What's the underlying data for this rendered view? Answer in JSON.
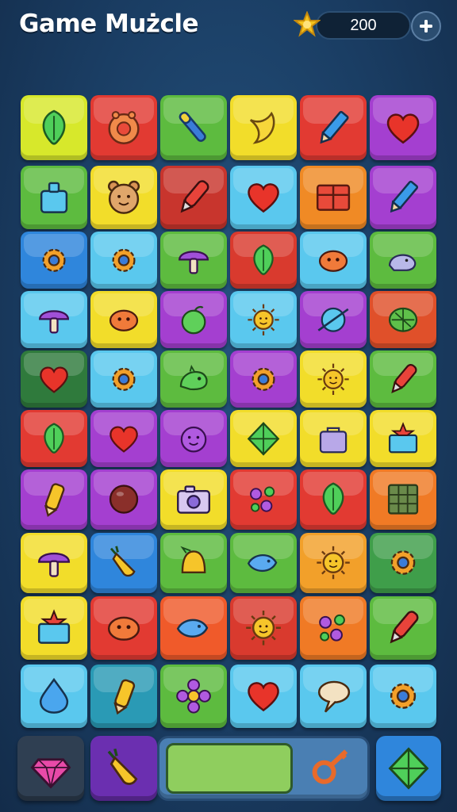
{
  "header": {
    "title": "Game Mużcle",
    "coins": "200",
    "coin_icon": "star-coin-icon",
    "add_icon": "plus-icon"
  },
  "board": {
    "rows": 10,
    "cols": 6,
    "tiles": [
      [
        {
          "color": "#d7e82b",
          "icon": "leaf"
        },
        {
          "color": "#e23a32",
          "icon": "clock"
        },
        {
          "color": "#5dbb3f",
          "icon": "pen"
        },
        {
          "color": "#f2dd2a",
          "icon": "banana"
        },
        {
          "color": "#e23a32",
          "icon": "pencil"
        },
        {
          "color": "#a43fd0",
          "icon": "heart"
        }
      ],
      [
        {
          "color": "#5dbb3f",
          "icon": "bottle"
        },
        {
          "color": "#f2dd2a",
          "icon": "bear"
        },
        {
          "color": "#c8352d",
          "icon": "marker"
        },
        {
          "color": "#5ac8ee",
          "icon": "heart"
        },
        {
          "color": "#f08a25",
          "icon": "crate"
        },
        {
          "color": "#a43fd0",
          "icon": "pencil"
        }
      ],
      [
        {
          "color": "#2f86dc",
          "icon": "gear"
        },
        {
          "color": "#5ac8ee",
          "icon": "gear"
        },
        {
          "color": "#5dbb3f",
          "icon": "mushroom"
        },
        {
          "color": "#d93a2e",
          "icon": "leaf"
        },
        {
          "color": "#5ac8ee",
          "icon": "blob"
        },
        {
          "color": "#5dbb3f",
          "icon": "whale"
        }
      ],
      [
        {
          "color": "#5ac8ee",
          "icon": "mushroom"
        },
        {
          "color": "#f2dd2a",
          "icon": "blob"
        },
        {
          "color": "#a43fd0",
          "icon": "apple"
        },
        {
          "color": "#5ac8ee",
          "icon": "sun"
        },
        {
          "color": "#a43fd0",
          "icon": "planet"
        },
        {
          "color": "#e0502a",
          "icon": "melon"
        }
      ],
      [
        {
          "color": "#2f7a3c",
          "icon": "heart"
        },
        {
          "color": "#5ac8ee",
          "icon": "gear"
        },
        {
          "color": "#5dbb3f",
          "icon": "dino"
        },
        {
          "color": "#a43fd0",
          "icon": "gear"
        },
        {
          "color": "#f2dd2a",
          "icon": "sun"
        },
        {
          "color": "#5dbb3f",
          "icon": "marker"
        }
      ],
      [
        {
          "color": "#e23a32",
          "icon": "leaf"
        },
        {
          "color": "#a43fd0",
          "icon": "heart"
        },
        {
          "color": "#a43fd0",
          "icon": "face"
        },
        {
          "color": "#f2dd2a",
          "icon": "kite"
        },
        {
          "color": "#f2dd2a",
          "icon": "bag"
        },
        {
          "color": "#f2dd2a",
          "icon": "box"
        }
      ],
      [
        {
          "color": "#a43fd0",
          "icon": "crayon"
        },
        {
          "color": "#a43fd0",
          "icon": "ball"
        },
        {
          "color": "#f2dd2a",
          "icon": "camera"
        },
        {
          "color": "#e23a32",
          "icon": "flowers"
        },
        {
          "color": "#e23a32",
          "icon": "leaf"
        },
        {
          "color": "#f07a25",
          "icon": "window"
        }
      ],
      [
        {
          "color": "#f2dd2a",
          "icon": "mushroom"
        },
        {
          "color": "#2f86dc",
          "icon": "carrot"
        },
        {
          "color": "#5dbb3f",
          "icon": "bell"
        },
        {
          "color": "#5dbb3f",
          "icon": "fish"
        },
        {
          "color": "#f2a02a",
          "icon": "sun"
        },
        {
          "color": "#3f9e4a",
          "icon": "gear"
        }
      ],
      [
        {
          "color": "#f2dd2a",
          "icon": "box"
        },
        {
          "color": "#e23a32",
          "icon": "blob"
        },
        {
          "color": "#f05a2a",
          "icon": "fish"
        },
        {
          "color": "#d93a2e",
          "icon": "sun"
        },
        {
          "color": "#f07a25",
          "icon": "flowers"
        },
        {
          "color": "#5dbb3f",
          "icon": "marker"
        }
      ],
      [
        {
          "color": "#5ac8ee",
          "icon": "drop"
        },
        {
          "color": "#2a9ab5",
          "icon": "crayon"
        },
        {
          "color": "#5dbb3f",
          "icon": "flower"
        },
        {
          "color": "#5ac8ee",
          "icon": "heart"
        },
        {
          "color": "#5ac8ee",
          "icon": "speech"
        },
        {
          "color": "#5ac8ee",
          "icon": "gear"
        }
      ]
    ]
  },
  "bottombar": {
    "slots": [
      {
        "name": "gem-booster-button",
        "color": "#2f3f52",
        "icon": "gem"
      },
      {
        "name": "carrot-booster-button",
        "color": "#6b2fb0",
        "icon": "carrot"
      },
      {
        "name": "key-booster-button",
        "color": "#4a7fb3",
        "icon": "key"
      },
      {
        "name": "kite-booster-button",
        "color": "#2f86dc",
        "icon": "kite"
      }
    ],
    "progress": 0.62
  }
}
